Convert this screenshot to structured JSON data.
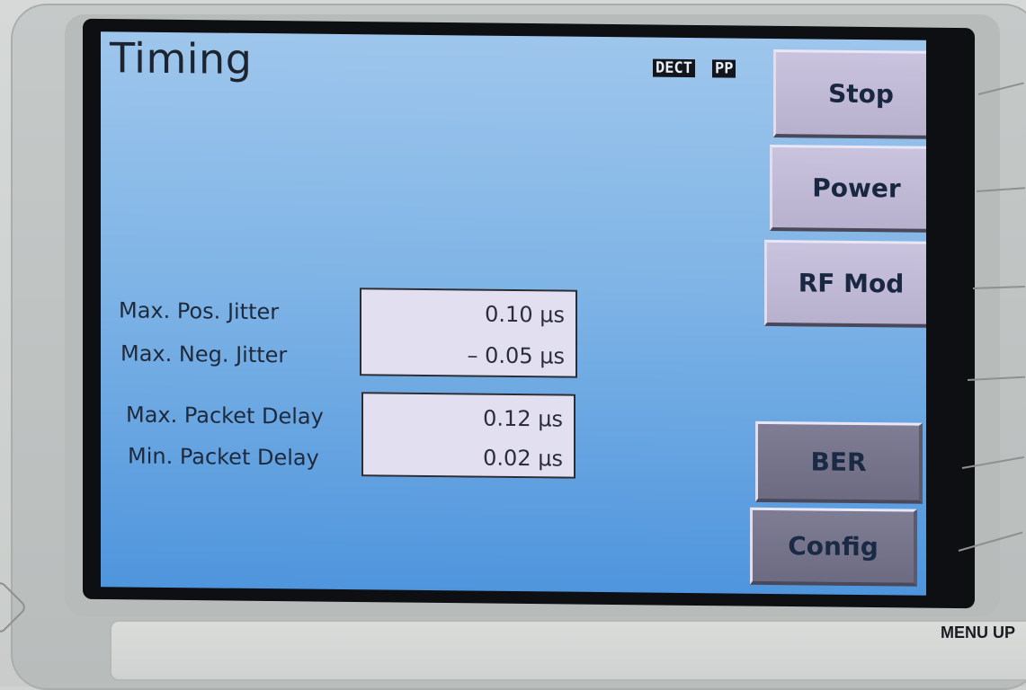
{
  "screen": {
    "title": "Timing",
    "badges": [
      "DECT",
      "PP"
    ]
  },
  "measurements": {
    "jitter": [
      {
        "label": "Max. Pos. Jitter",
        "value": "0.10 µs"
      },
      {
        "label": "Max. Neg. Jitter",
        "value": "– 0.05 µs"
      }
    ],
    "packet_delay": [
      {
        "label": "Max. Packet Delay",
        "value": "0.12 µs"
      },
      {
        "label": "Min. Packet Delay",
        "value": "0.02 µs"
      }
    ]
  },
  "softkeys": [
    {
      "label": "Stop"
    },
    {
      "label": "Power"
    },
    {
      "label": "RF Mod"
    },
    {
      "label": "BER"
    },
    {
      "label": "Config"
    }
  ],
  "hardware": {
    "menu_label": "MENU UP"
  },
  "colors": {
    "screen_top": "#9ec6ec",
    "screen_bottom": "#4f95dd",
    "softkey_face": "#c9c3de",
    "softkey_dark_face": "#7f7d94",
    "value_box": "#e2dff0"
  }
}
